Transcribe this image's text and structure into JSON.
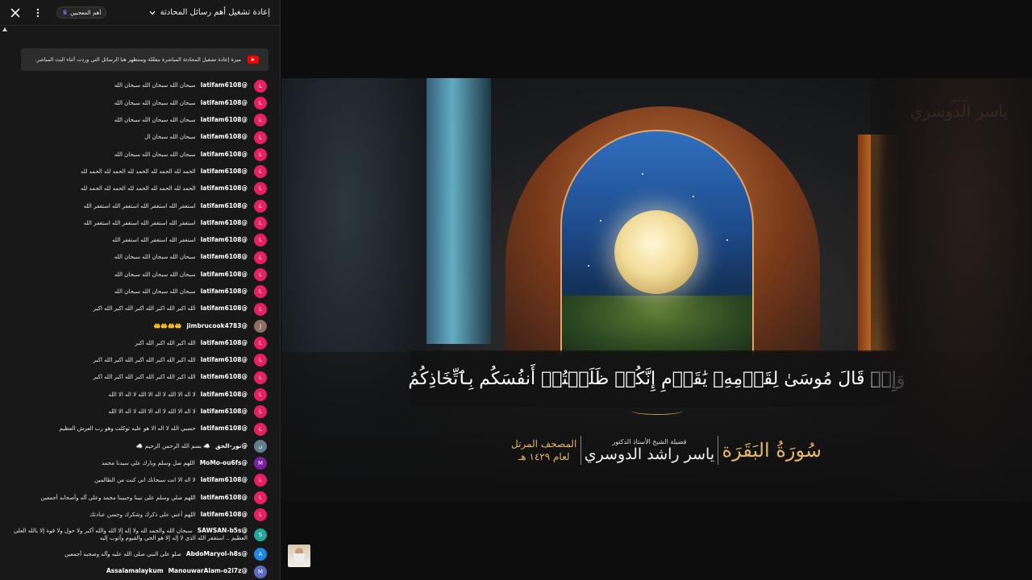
{
  "chat": {
    "header": {
      "title": "إعادة تشغيل أهم رسائل المحادثة",
      "members_badge": "أهم المعجبين",
      "colors": {
        "background": "#181818",
        "text": "#f1f1f1"
      }
    },
    "notice": "ميزة إعادة تشغيل المحادثة المباشرة مفعّلة وستظهر هنا الرسائل التي وردت أثناء البث المباشر.",
    "messages": [
      {
        "author": "@latifam6108",
        "initial": "L",
        "color": "#e91e63",
        "text": "سبحان الله سبحان الله سبحان الله"
      },
      {
        "author": "@latifam6108",
        "initial": "L",
        "color": "#e91e63",
        "text": "سبحان الله سبحان الله سبحان الله"
      },
      {
        "author": "@latifam6108",
        "initial": "L",
        "color": "#e91e63",
        "text": "سبحان الله سبحان الله سبحان الله"
      },
      {
        "author": "@latifam6108",
        "initial": "L",
        "color": "#e91e63",
        "text": "سبحان الله سبحان ال"
      },
      {
        "author": "@latifam6108",
        "initial": "L",
        "color": "#e91e63",
        "text": "سبحان الله سبحان الله سبحان الله"
      },
      {
        "author": "@latifam6108",
        "initial": "L",
        "color": "#e91e63",
        "text": "الحمد لله الحمد لله الحمد لله الحمد لله الحمد لله"
      },
      {
        "author": "@latifam6108",
        "initial": "L",
        "color": "#e91e63",
        "text": "الحمد لله الحمد لله الحمد لله الحمد لله الحمد لله"
      },
      {
        "author": "@latifam6108",
        "initial": "L",
        "color": "#e91e63",
        "text": "استغفر الله استغفر الله استغفر الله استغفر الله"
      },
      {
        "author": "@latifam6108",
        "initial": "L",
        "color": "#e91e63",
        "text": "استغفر الله استغفر الله استغفر الله استغفر الله"
      },
      {
        "author": "@latifam6108",
        "initial": "L",
        "color": "#e91e63",
        "text": "استغفر الله استغفر الله استغفر الله"
      },
      {
        "author": "@latifam6108",
        "initial": "L",
        "color": "#e91e63",
        "text": "سبحان الله سبحان الله سبحان الله"
      },
      {
        "author": "@latifam6108",
        "initial": "L",
        "color": "#e91e63",
        "text": "سبحان الله سبحان الله سبحان الله"
      },
      {
        "author": "@latifam6108",
        "initial": "L",
        "color": "#e91e63",
        "text": "سبحان الله سبحان الله سبحان الله"
      },
      {
        "author": "@latifam6108",
        "initial": "L",
        "color": "#e91e63",
        "text": "الله اكبر الله اكبر الله اكبر الله اكبر الله اكبر"
      },
      {
        "author": "@jimbrucook4783",
        "initial": "J",
        "color": "#8d6e63",
        "text": "🤲🤲🤲🤲"
      },
      {
        "author": "@latifam6108",
        "initial": "L",
        "color": "#e91e63",
        "text": "الله اكبر الله اكبر الله اكبر"
      },
      {
        "author": "@latifam6108",
        "initial": "L",
        "color": "#e91e63",
        "text": "الله اكبر الله اكبر الله اكبر الله اكبر الله اكبر"
      },
      {
        "author": "@latifam6108",
        "initial": "L",
        "color": "#e91e63",
        "text": "الله اكبر الله اكبر الله اكبر الله اكبر الله اكبر"
      },
      {
        "author": "@latifam6108",
        "initial": "L",
        "color": "#e91e63",
        "text": "لا اله الا الله لا اله الا الله لا اله الا الله"
      },
      {
        "author": "@latifam6108",
        "initial": "L",
        "color": "#e91e63",
        "text": "لا اله الا الله لا اله الا الله لا اله الا الله"
      },
      {
        "author": "@latifam6108",
        "initial": "L",
        "color": "#e91e63",
        "text": "حسبي الله لا اله الا هو عليه توكلت وهو رب العرش العظيم"
      },
      {
        "author": "@نور-الحق",
        "initial": "ن",
        "color": "#607d8b",
        "text": "☁️ بسم الله الرحمن الرحيم ☁️"
      },
      {
        "author": "@MoMo-ou6fs",
        "initial": "M",
        "color": "#7b1fa2",
        "text": "اللهم صل وسلم وبارك على سيدنا محمد"
      },
      {
        "author": "@latifam6108",
        "initial": "L",
        "color": "#e91e63",
        "text": "لا اله الا انت سبحانك اني كنت من الظالمين"
      },
      {
        "author": "@latifam6108",
        "initial": "L",
        "color": "#e91e63",
        "text": "اللهم صلي وسلم على نبينا وحبيبنا محمد وعلى آله وأصحابه أجمعين"
      },
      {
        "author": "@latifam6108",
        "initial": "L",
        "color": "#e91e63",
        "text": "اللهم أعني على ذكرك وشكرك وحسن عبادتك"
      },
      {
        "author": "@SAWSAN-b5s",
        "initial": "S",
        "color": "#26a69a",
        "text": "سبحان الله والحمد لله ولا إله إلا الله والله أكبر ولا حول ولا قوة إلا بالله العلي العظيم .. استغفر الله الذي لا إله إلا هو الحي والقيوم وأتوب إليه",
        "tall": true
      },
      {
        "author": "@AbdoMaryol-h8s",
        "initial": "A",
        "color": "#1e88e5",
        "text": "صلو على النبي صلى الله عليه وآله وصحبه أجمعين"
      },
      {
        "author": "@ManouwarAlam-o2i7z",
        "initial": "M",
        "color": "#5c6bc0",
        "text": "Assalamalaykum",
        "last": true
      }
    ]
  },
  "video": {
    "verse": "وَإِذۡ قَالَ مُوسَىٰ لِقَوۡمِهِۦ يَٰقَوۡمِ إِنَّكُمۡ ظَلَمۡتُمۡ أَنفُسَكُم بِٱتِّخَاذِكُمُ",
    "surah": "سُورَةُ البَقَرَة",
    "reciter_title": "فضيلة الشيخ الأستاذ الدكتور",
    "reciter_name": "ياسر راشد الدوسري",
    "mushaf_line1": "المصحف المرتل",
    "mushaf_line2": "لعام ١٤٢٩ هـ",
    "logo_small": "الدكتور",
    "logo_big": "ياسر الدوسري",
    "accent_color": "#e3b66a"
  }
}
